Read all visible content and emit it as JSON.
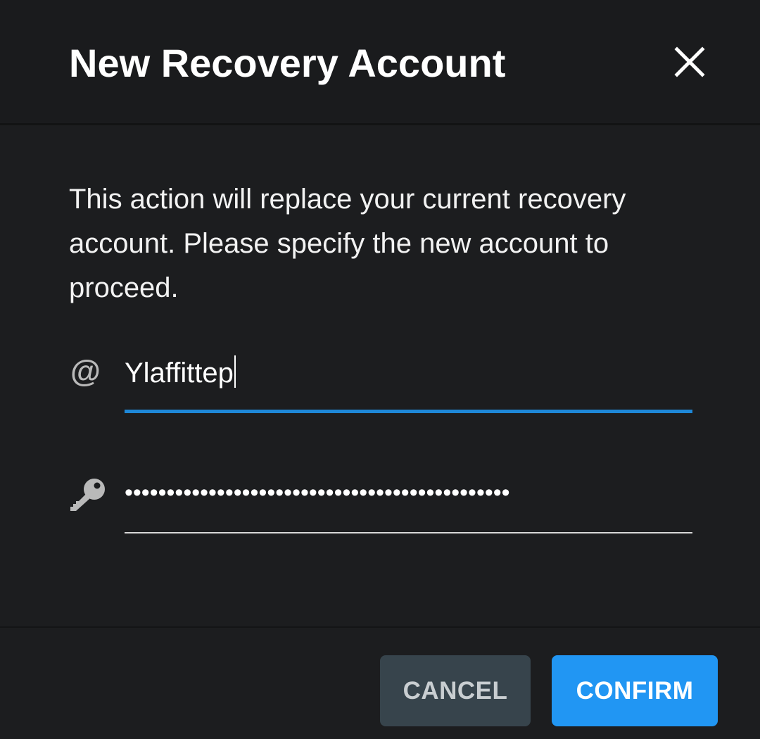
{
  "dialog": {
    "title": "New Recovery Account",
    "message": "This action will replace your current recovery account. Please specify the new account to proceed."
  },
  "form": {
    "username": {
      "icon": "at-sign-icon",
      "value": "Ylaffittep"
    },
    "password": {
      "icon": "key-icon",
      "masked_value": "••••••••••••••••••••••••••••••••••••••••••••••"
    }
  },
  "actions": {
    "cancel_label": "CANCEL",
    "confirm_label": "CONFIRM"
  },
  "colors": {
    "background": "#1c1d1f",
    "accent": "#2196f3",
    "focus_underline": "#1e88d8",
    "cancel_button": "#37444c"
  }
}
